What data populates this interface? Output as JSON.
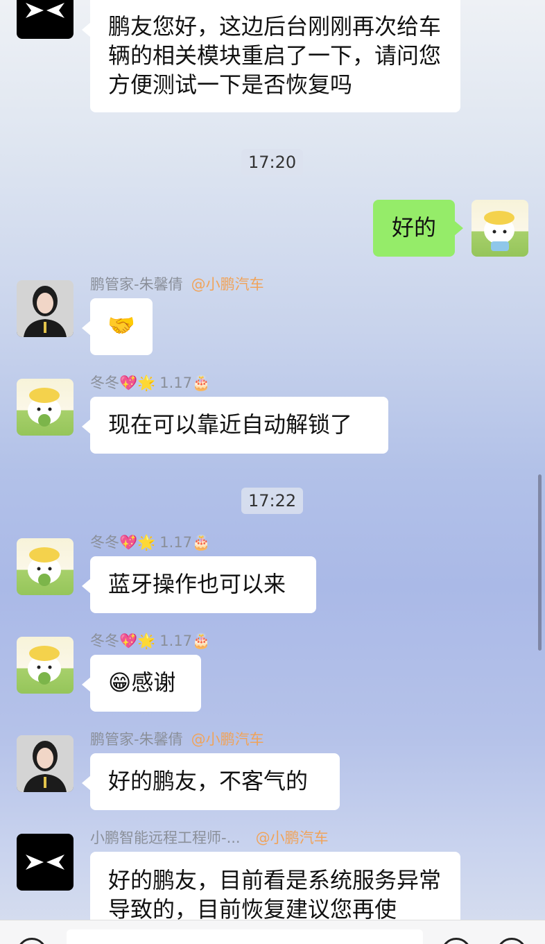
{
  "messages": {
    "m1_text": "鹏友您好，这边后台刚刚再次给车辆的相关模块重启了一下，请问您方便测试一下是否恢复吗",
    "time1": "17:20",
    "m2_text": "好的",
    "m3_sender": "鹏管家-朱馨倩",
    "m3_org": "@小鹏汽车",
    "m3_text": "🤝",
    "m4_sender": "冬冬💖🌟",
    "m4_ver": "1.17🎂",
    "m4_text": "现在可以靠近自动解锁了",
    "time2": "17:22",
    "m5_sender": "冬冬💖🌟",
    "m5_ver": "1.17🎂",
    "m5_text": "蓝牙操作也可以来",
    "m6_sender": "冬冬💖🌟",
    "m6_ver": "1.17🎂",
    "m6_text": "😁感谢",
    "m7_sender": "鹏管家-朱馨倩",
    "m7_org": "@小鹏汽车",
    "m7_text": "好的鹏友，不客气的",
    "m8_sender": "小鹏智能远程工程师-...",
    "m8_org": "@小鹏汽车",
    "m8_text": "好的鹏友，目前看是系统服务异常导致的，目前恢复建议您再使"
  },
  "icons": {
    "xpeng_logo": "xpeng-logo-icon",
    "voice": "voice-icon",
    "emoji": "emoji-icon",
    "plus": "plus-icon"
  },
  "colors": {
    "bubble_self": "#95ec69",
    "bubble_other": "#ffffff",
    "org_tag": "#f0a35a"
  }
}
